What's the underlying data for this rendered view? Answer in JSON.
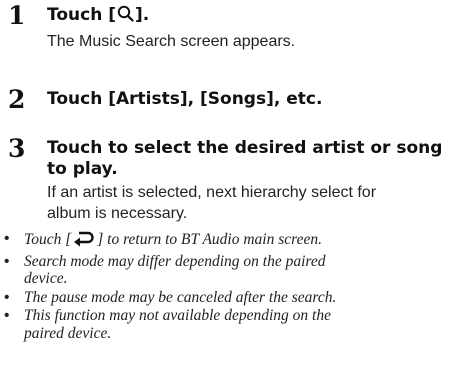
{
  "steps": [
    {
      "number": "1",
      "heading_prefix": "Touch [",
      "heading_icon": "search-icon",
      "heading_suffix": "].",
      "body": "The Music Search screen appears."
    },
    {
      "number": "2",
      "heading_prefix": "Touch ",
      "heading_items": [
        "[Artists]",
        "[Songs]"
      ],
      "heading_sep": ", ",
      "heading_suffix": ", etc."
    },
    {
      "number": "3",
      "heading_line1": "Touch to select the desired artist or song",
      "heading_line2": "to play.",
      "body_line1": "If an artist is selected, next hierarchy select for",
      "body_line2": "album is necessary."
    }
  ],
  "notes": {
    "note1_prefix": "Touch [",
    "note1_icon": "return-arrow-icon",
    "note1_suffix": "] to return to BT Audio main screen.",
    "note2_line1": "Search mode may differ depending on the paired",
    "note2_line2": "device.",
    "note3": "The pause mode may be canceled after the search.",
    "note4_line1": "This function may not available depending on the",
    "note4_line2": "paired device.",
    "bullet": "•"
  }
}
